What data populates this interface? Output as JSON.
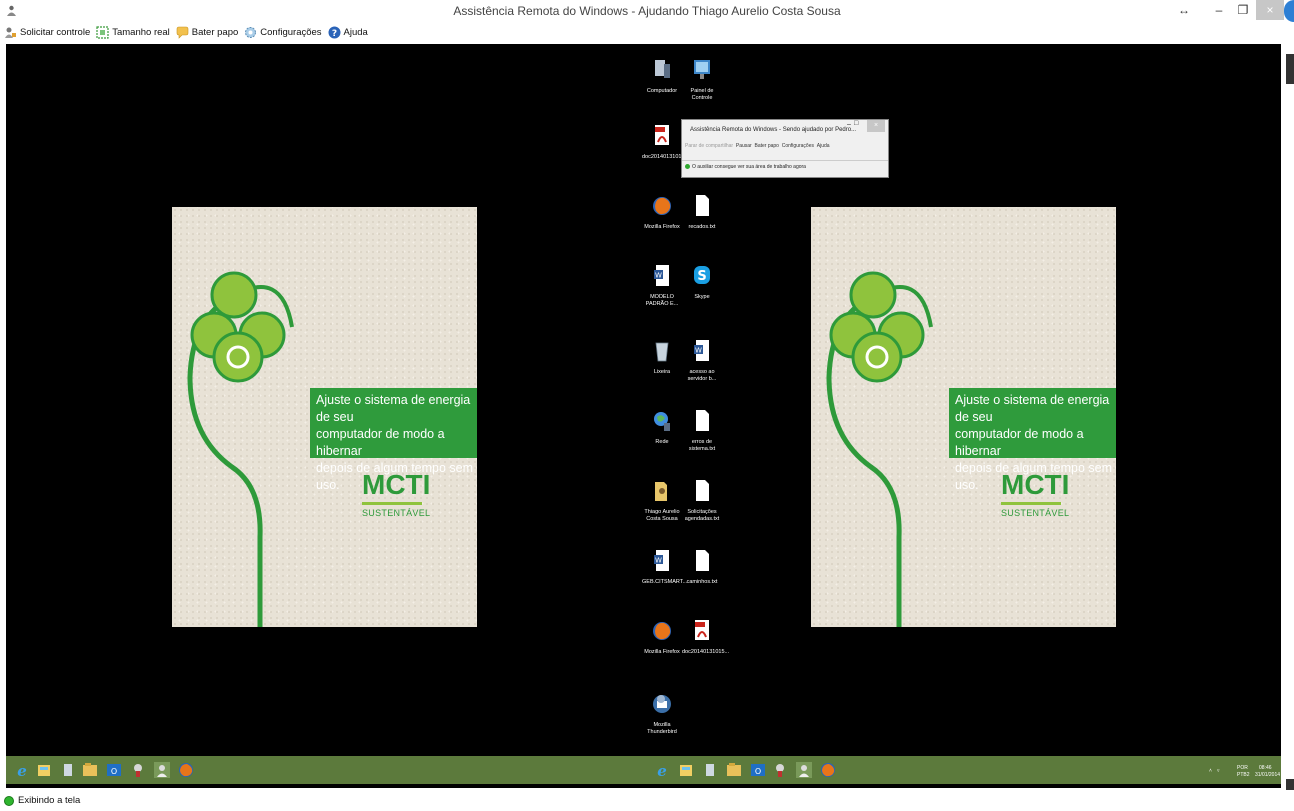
{
  "window": {
    "title": "Assistência Remota do Windows - Ajudando Thiago Aurelio Costa Sousa",
    "resize_symbol": "↔",
    "min_symbol": "–",
    "max_symbol": "❐",
    "close_symbol": "×"
  },
  "toolbar": {
    "items": [
      {
        "label": "Solicitar controle",
        "icon": "request-control-icon"
      },
      {
        "label": "Tamanho real",
        "icon": "actual-size-icon"
      },
      {
        "label": "Bater papo",
        "icon": "chat-icon"
      },
      {
        "label": "Configurações",
        "icon": "settings-icon"
      },
      {
        "label": "Ajuda",
        "icon": "help-icon"
      }
    ]
  },
  "remote_desktop": {
    "poster_left": {
      "banner_lines": [
        "Ajuste o sistema de energia de seu",
        "computador de modo a hibernar",
        "depois de algum tempo sem uso."
      ],
      "brand": "MCTI",
      "brand_sub": "SUSTENTÁVEL"
    },
    "poster_right": {
      "banner_lines": [
        "Ajuste o sistema de energia de seu",
        "computador de modo a hibernar",
        "depois de algum tempo sem uso."
      ],
      "brand": "MCTI",
      "brand_sub": "SUSTENTÁVEL"
    },
    "icons": [
      {
        "label": "Computador"
      },
      {
        "label": "Painel de Controle"
      },
      {
        "label": "doc20140131013..."
      },
      {
        "label": "Mozilla Firefox"
      },
      {
        "label": "recados.txt"
      },
      {
        "label": "MODELO PADRÃO E..."
      },
      {
        "label": "Skype"
      },
      {
        "label": "Lixeira"
      },
      {
        "label": "acesso ao servidor b..."
      },
      {
        "label": "Rede"
      },
      {
        "label": "erros de sistema.txt"
      },
      {
        "label": "Thiago Aurelio Costa Sousa"
      },
      {
        "label": "Solicitações agendadas.txt"
      },
      {
        "label": "GEB.CITSMART..."
      },
      {
        "label": "caminhos.txt"
      },
      {
        "label": "Mozilla Firefox"
      },
      {
        "label": "doc20140131015..."
      },
      {
        "label": "Mozilla Thunderbird"
      }
    ],
    "inner_window": {
      "title": "Assistência Remota do Windows - Sendo ajudado por Pedro...",
      "toolbar": [
        "Parar de compartilhar",
        "Pausar",
        "Bater papo",
        "Configurações",
        "Ajuda"
      ],
      "status": "O auxiliar consegue ver sua área de trabalho agora"
    },
    "tray": {
      "lang": "POR",
      "layout": "PTB2",
      "time": "08:46",
      "date": "31/01/2014"
    }
  },
  "statusbar": {
    "text": "Exibindo a tela"
  },
  "colors": {
    "taskbar": "#5c7a3c",
    "banner": "#2f9b3c",
    "poster_bg": "#e8e2d6"
  }
}
